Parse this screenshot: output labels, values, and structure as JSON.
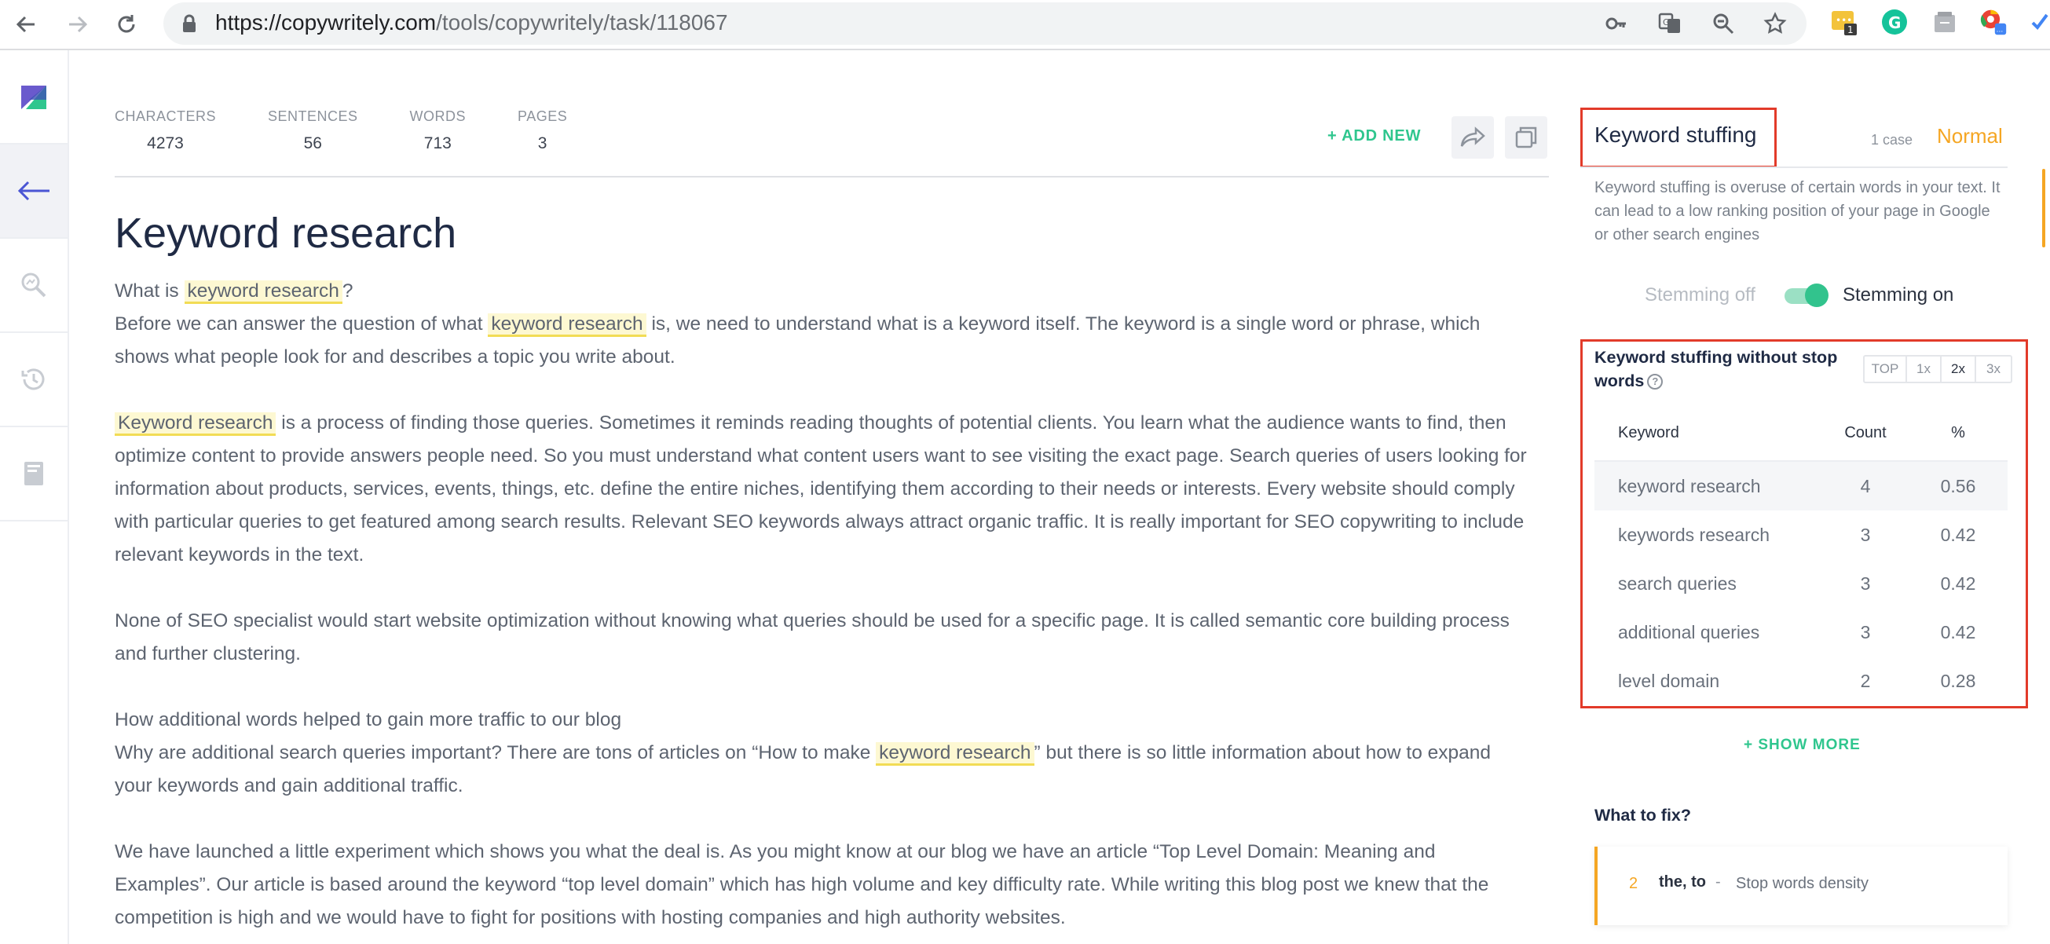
{
  "browser": {
    "url_domain": "https://copywritely.com",
    "url_path": "/tools/copywritely/task/118067",
    "extension_badge": "1"
  },
  "stats": [
    {
      "label": "CHARACTERS",
      "value": "4273"
    },
    {
      "label": "SENTENCES",
      "value": "56"
    },
    {
      "label": "WORDS",
      "value": "713"
    },
    {
      "label": "PAGES",
      "value": "3"
    }
  ],
  "toolbar": {
    "add_new": "+ ADD NEW"
  },
  "document": {
    "title": "Keyword research",
    "highlight": "keyword research",
    "highlight_cap": "Keyword research",
    "p1a": "What is ",
    "p1b": "?",
    "p2a": "Before we can answer the question of what ",
    "p2b": " is, we need to understand what is a keyword itself. The keyword is a single word or phrase, which shows what people look for and describes a topic you write about.",
    "p3b": " is a process of finding those queries. Sometimes it reminds reading thoughts of potential clients. You learn what the audience wants to find, then optimize content to provide answers people need. So you must understand what content users want to see visiting the exact page. Search queries of users looking for information about products, services, events, things, etc. define the entire niches, identifying them according to their needs or interests. Every website should comply with particular queries to get featured among search results. Relevant SEO keywords always attract organic traffic. It is really important for SEO copywriting to include relevant keywords in the text.",
    "p4": "None of SEO specialist would start website optimization without knowing what queries should be used for a specific page. It is called semantic core building process and further clustering.",
    "p5": "How additional words helped to gain more traffic to our blog",
    "p6a": "Why are additional search queries important? There are tons of articles on “How to make ",
    "p6b": "” but there is so little information about how to expand your keywords and gain additional traffic.",
    "p7": "We have launched a little experiment which shows you what the deal is. As you might know at our blog we have an article “Top Level Domain: Meaning and Examples”. Our article is based around the keyword “top level domain” which has high volume and key difficulty rate. While writing this blog post we knew that the competition is high and we would have to fight for positions with hosting companies and high authority websites."
  },
  "panel": {
    "title": "Keyword stuffing",
    "cases": "1 case",
    "level": "Normal",
    "level_color": "#f5a623",
    "description": "Keyword stuffing is overuse of certain words in your text. It can lead to a low ranking position of your page in Google or other search engines",
    "stemming_off": "Stemming off",
    "stemming_on": "Stemming on",
    "stemming_enabled": true,
    "table_title": "Keyword stuffing without stop words",
    "tabs": [
      "TOP",
      "1x",
      "2x",
      "3x"
    ],
    "active_tab": "2x",
    "columns": {
      "keyword": "Keyword",
      "count": "Count",
      "pct": "%"
    },
    "rows": [
      {
        "keyword": "keyword research",
        "count": "4",
        "pct": "0.56"
      },
      {
        "keyword": "keywords research",
        "count": "3",
        "pct": "0.42"
      },
      {
        "keyword": "search queries",
        "count": "3",
        "pct": "0.42"
      },
      {
        "keyword": "additional queries",
        "count": "3",
        "pct": "0.42"
      },
      {
        "keyword": "level domain",
        "count": "2",
        "pct": "0.28"
      }
    ],
    "show_more": "+ SHOW MORE",
    "fix_title": "What to fix?",
    "fix": {
      "num": "2",
      "words": "the, to",
      "sep": "-",
      "desc": "Stop words density"
    }
  },
  "colors": {
    "accent_green": "#2fc68e",
    "warning_orange": "#f5a623",
    "highlight_yellow": "#fdf8d2",
    "annotation_red": "#e23b2a"
  }
}
